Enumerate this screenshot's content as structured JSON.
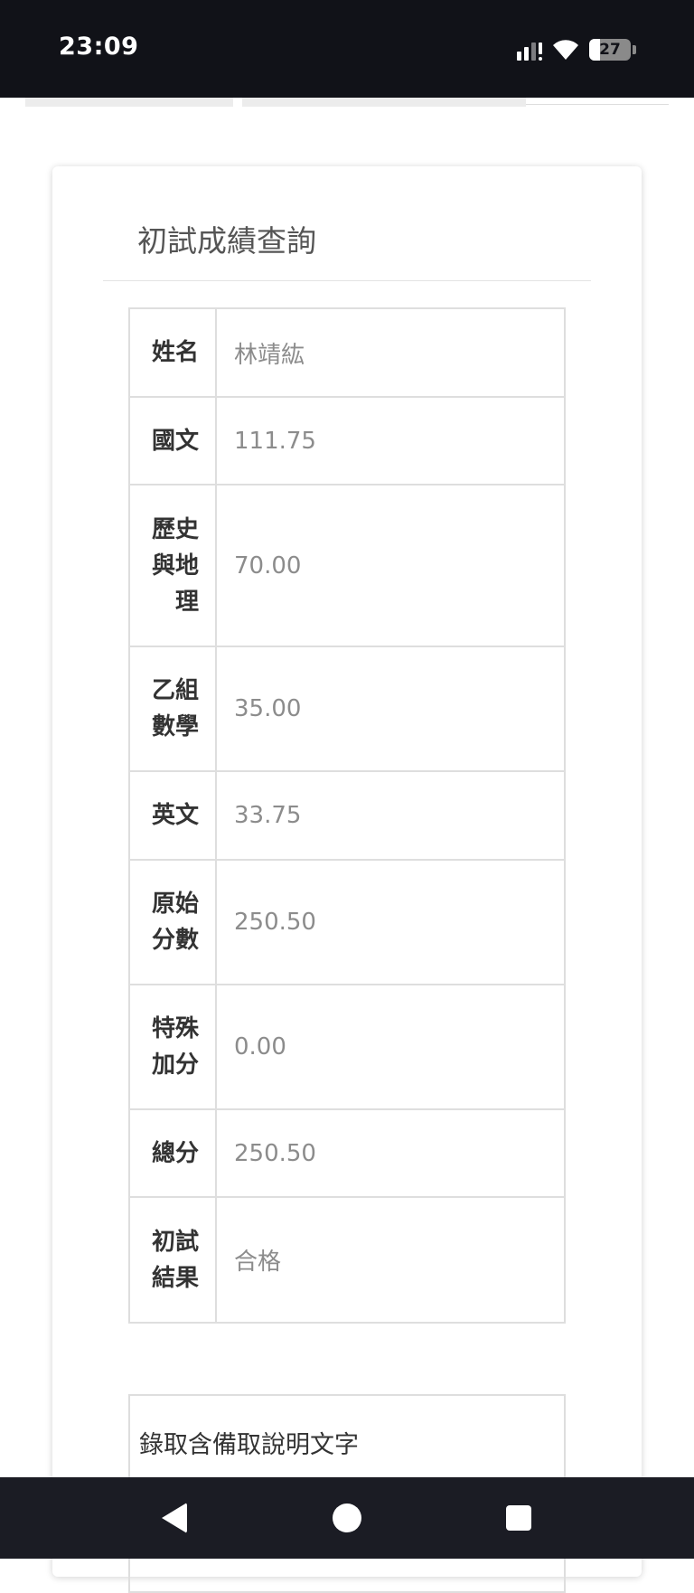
{
  "status_bar": {
    "time": "23:09",
    "battery_level": "27",
    "battery_fraction": 0.27,
    "icons": [
      "signal-icon",
      "wifi-icon",
      "battery-icon"
    ]
  },
  "card": {
    "title": "初試成績查詢"
  },
  "scores": [
    {
      "label": "姓名",
      "value": "林靖紘"
    },
    {
      "label": "國文",
      "value": "111.75"
    },
    {
      "label": "歷史與地理",
      "value": "70.00"
    },
    {
      "label": "乙組數學",
      "value": "35.00"
    },
    {
      "label": "英文",
      "value": "33.75"
    },
    {
      "label": "原始分數",
      "value": "250.50"
    },
    {
      "label": "特殊加分",
      "value": "0.00"
    },
    {
      "label": "總分",
      "value": "250.50"
    },
    {
      "label": "初試結果",
      "value": "合格"
    }
  ],
  "note": {
    "text": "錄取含備取說明文字"
  },
  "nav_bar": {
    "icons": [
      "back-icon",
      "home-icon",
      "recents-icon"
    ]
  }
}
